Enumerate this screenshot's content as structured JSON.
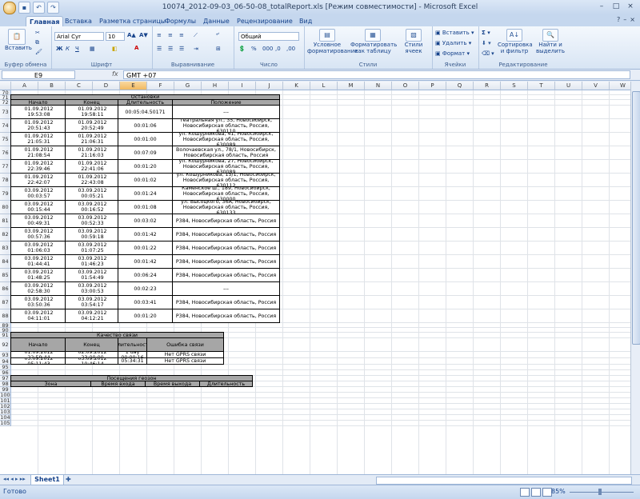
{
  "window": {
    "title": "10074_2012-09-03_06-50-08_totalReport.xls  [Режим совместимости] - Microsoft Excel",
    "controls": [
      "–",
      "□",
      "×"
    ]
  },
  "ribbon_tabs": [
    {
      "label": "Главная",
      "active": true
    },
    {
      "label": "Вставка"
    },
    {
      "label": "Разметка страницы"
    },
    {
      "label": "Формулы"
    },
    {
      "label": "Данные"
    },
    {
      "label": "Рецензирование"
    },
    {
      "label": "Вид"
    }
  ],
  "ribbon": {
    "groups": [
      "Буфер обмена",
      "Шрифт",
      "Выравнивание",
      "Число",
      "Стили",
      "Ячейки",
      "Редактирование"
    ],
    "paste_label": "Вставить",
    "font_name": "Arial Cyr",
    "font_size": "10",
    "number_format": "Общий",
    "number_buttons": [
      "% ",
      "000",
      ",0",
      ",00"
    ],
    "font_buttons": [
      "Ж",
      "К",
      "Ч"
    ],
    "cond_format_label": "Условное форматирование",
    "format_table_label": "Форматировать как таблицу",
    "cell_styles_label": "Стили ячеек",
    "insert_label": "Вставить",
    "delete_label": "Удалить",
    "format_label": "Формат",
    "sort_label": "Сортировка и фильтр",
    "find_label": "Найти и выделить"
  },
  "formula_bar": {
    "name_box": "E9",
    "fx": "fx",
    "value": "GMT +07"
  },
  "columns": [
    "A",
    "B",
    "C",
    "D",
    "E",
    "F",
    "G",
    "H",
    "I",
    "J",
    "K",
    "L",
    "M",
    "N",
    "O",
    "P",
    "Q",
    "R",
    "S",
    "T",
    "U",
    "V",
    "W"
  ],
  "selected_column": "E",
  "rows": [
    "70",
    "71",
    "72",
    "73",
    "74",
    "75",
    "76",
    "77",
    "78",
    "79",
    "80",
    "81",
    "82",
    "83",
    "84",
    "85",
    "86",
    "87",
    "88",
    "89",
    "90",
    "91",
    "92",
    "93",
    "94",
    "95",
    "96",
    "97",
    "98",
    "99",
    "100",
    "101",
    "102",
    "103",
    "104",
    "105"
  ],
  "stops": {
    "title": "Остановки",
    "headers": [
      "Начало",
      "Конец",
      "Длительность",
      "Положение"
    ],
    "rows": [
      [
        "01.09.2012 19:53:08",
        "01.09.2012 19:58:11",
        "00:05:04.50171",
        "---"
      ],
      [
        "01.09.2012 20:51:43",
        "01.09.2012 20:52:49",
        "00:01:06",
        "Театральная ул., 35, Новосибирск, Новосибирская область, Россия, 630110"
      ],
      [
        "01.09.2012 21:05:31",
        "01.09.2012 21:06:31",
        "00:01:00",
        "ул. Кошурникова, 41, Новосибирск, Новосибирская область, Россия, 630089"
      ],
      [
        "01.09.2012 21:08:54",
        "01.09.2012 21:16:03",
        "00:07:09",
        "Волочаевская ул., 78/1, Новосибирск, Новосибирская область, Россия"
      ],
      [
        "01.09.2012 22:39:46",
        "01.09.2012 22:41:06",
        "00:01:20",
        "ул. Кошурникова, 27, Новосибирск, Новосибирская область, Россия, 630089"
      ],
      [
        "01.09.2012 22:42:07",
        "01.09.2012 22:43:08",
        "00:01:02",
        "ул. Кошурникова, 15/1, Новосибирск, Новосибирская область, Россия, 630112"
      ],
      [
        "03.09.2012 00:03:57",
        "03.09.2012 00:05:21",
        "00:01:24",
        "Каменское ш., 189, Новосибирск, Новосибирская область, Россия, 630000"
      ],
      [
        "03.09.2012 00:15:44",
        "03.09.2012 00:16:52",
        "00:01:08",
        "ул. Высоцкого, 36А, Новосибирск, Новосибирская область, Россия, 630133"
      ],
      [
        "03.09.2012 00:49:31",
        "03.09.2012 00:52:33",
        "00:03:02",
        "Р384, Новосибирская область, Россия"
      ],
      [
        "03.09.2012 00:57:36",
        "03.09.2012 00:59:18",
        "00:01:42",
        "Р384, Новосибирская область, Россия"
      ],
      [
        "03.09.2012 01:06:03",
        "03.09.2012 01:07:25",
        "00:01:22",
        "Р384, Новосибирская область, Россия"
      ],
      [
        "03.09.2012 01:44:41",
        "03.09.2012 01:46:23",
        "00:01:42",
        "Р384, Новосибирская область, Россия"
      ],
      [
        "03.09.2012 01:48:25",
        "03.09.2012 01:54:49",
        "00:06:24",
        "Р384, Новосибирская область, Россия"
      ],
      [
        "03.09.2012 02:58:30",
        "03.09.2012 03:00:53",
        "00:02:23",
        "---"
      ],
      [
        "03.09.2012 03:50:36",
        "03.09.2012 03:54:17",
        "00:03:41",
        "Р384, Новосибирская область, Россия"
      ],
      [
        "03.09.2012 04:11:01",
        "03.09.2012 04:12:21",
        "00:01:20",
        "Р384, Новосибирская область, Россия"
      ]
    ]
  },
  "connection": {
    "title": "Качество связи",
    "headers": [
      "Начало",
      "Конец",
      "Длительность",
      "Ошибка связи"
    ],
    "rows": [
      [
        "01.09.2012 22:59:44",
        "02.09.2012 23:00:00",
        "1 day 00:00:16",
        "Нет GPRS связи"
      ],
      [
        "03.09.2012 05:11:43",
        "03.09.2012 10:46:14",
        "05:34:31",
        "Нет GPRS связи"
      ]
    ]
  },
  "geozones": {
    "title": "Посещения геозон",
    "headers": [
      "Зона",
      "Время входа",
      "Время выхода",
      "Длительность"
    ]
  },
  "sheet_tab": "Sheet1",
  "status": {
    "ready": "Готово",
    "zoom": "85%"
  }
}
